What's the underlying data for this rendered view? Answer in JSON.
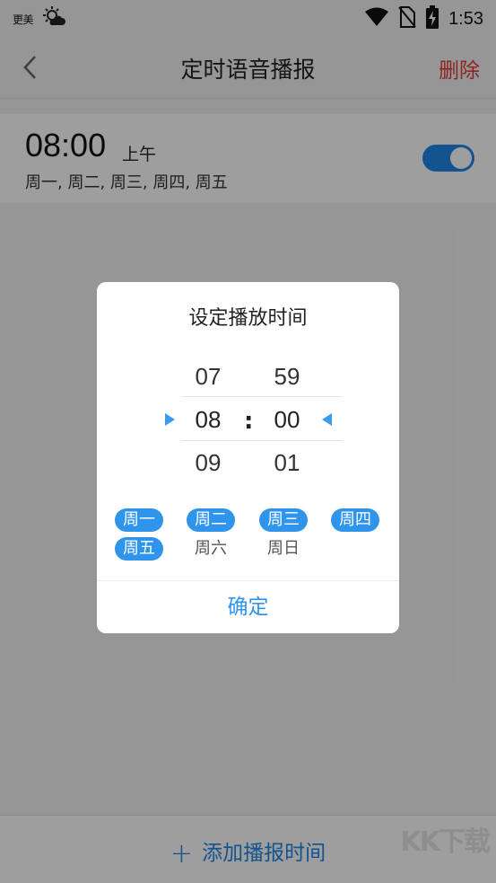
{
  "status_bar": {
    "carrier": "更美",
    "time": "1:53",
    "icons": [
      "weather-icon",
      "wifi-icon",
      "no-sim-icon",
      "battery-charging-icon"
    ]
  },
  "header": {
    "title": "定时语音播报",
    "delete_label": "删除"
  },
  "alarm": {
    "time": "08:00",
    "ampm": "上午",
    "days": "周一, 周二, 周三, 周四, 周五",
    "enabled": true
  },
  "dialog": {
    "title": "设定播放时间",
    "hours": {
      "prev": "07",
      "current": "08",
      "next": "09"
    },
    "minutes": {
      "prev": "59",
      "current": "00",
      "next": "01"
    },
    "separator": ":",
    "days": [
      {
        "label": "周一",
        "selected": true
      },
      {
        "label": "周二",
        "selected": true
      },
      {
        "label": "周三",
        "selected": true
      },
      {
        "label": "周四",
        "selected": true
      },
      {
        "label": "周五",
        "selected": true
      },
      {
        "label": "周六",
        "selected": false
      },
      {
        "label": "周日",
        "selected": false
      }
    ],
    "confirm_label": "确定"
  },
  "footer": {
    "add_label": "添加播报时间",
    "plus": "+"
  },
  "watermark": "KK下载",
  "colors": {
    "accent": "#2f95ec",
    "delete": "#e33a3a"
  }
}
